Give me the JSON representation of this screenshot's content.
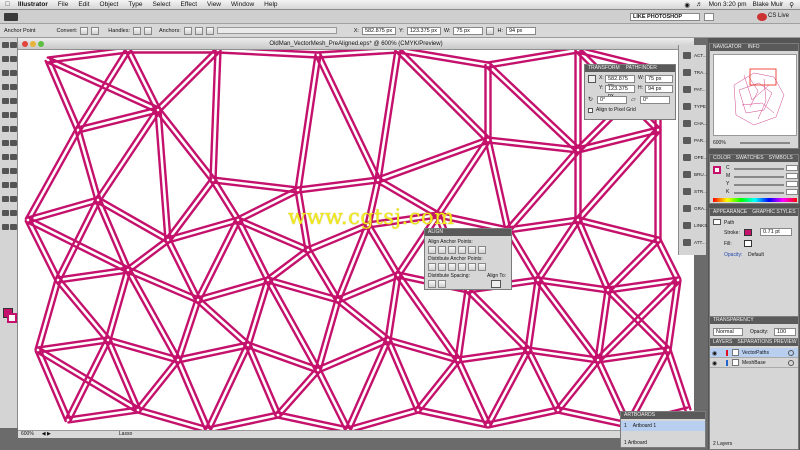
{
  "menubar": {
    "app_name": "Illustrator",
    "items": [
      "File",
      "Edit",
      "Object",
      "Type",
      "Select",
      "Effect",
      "View",
      "Window",
      "Help"
    ],
    "clock": "Mon 3:20 pm",
    "user": "Blake Muir"
  },
  "appbar": {
    "workspace": "LIKE PHOTOSHOP",
    "cs_live": "CS Live"
  },
  "controlbar": {
    "tool_label": "Anchor Point",
    "convert_label": "Convert:",
    "handles_label": "Handles:",
    "anchors_label": "Anchors:",
    "x_label": "X:",
    "x_value": "582.875 px",
    "y_label": "Y:",
    "y_value": "123.375 px",
    "w_label": "W:",
    "w_value": "75 px",
    "h_label": "H:",
    "h_value": "94 px"
  },
  "document": {
    "title": "OldMan_VectorMesh_PreAligned.eps* @ 600% (CMYK/Preview)",
    "zoom": "600%",
    "status_tool": "Lasso",
    "watermark": "www.cgtsj.com",
    "stroke_color": "#c4116b"
  },
  "transform_panel": {
    "tabs": [
      "TRANSFORM",
      "PATHFINDER"
    ],
    "x_label": "X:",
    "x_value": "582.875 px",
    "y_label": "Y:",
    "y_value": "123.375 px",
    "w_label": "W:",
    "w_value": "75 px",
    "h_label": "H:",
    "h_value": "94 px",
    "rotate_value": "0°",
    "shear_value": "0°",
    "align_pixel_grid": "Align to Pixel Grid"
  },
  "align_panel": {
    "tab": "ALIGN",
    "align_objects": "Align Anchor Points:",
    "distribute_objects": "Distribute Anchor Points:",
    "distribute_spacing": "Distribute Spacing:",
    "align_to": "Align To:"
  },
  "dock_icons": [
    {
      "label": "ACT...",
      "icon": "actions-icon"
    },
    {
      "label": "TRA...",
      "icon": "transform-icon"
    },
    {
      "label": "PAT...",
      "icon": "pathfinder-icon"
    },
    {
      "label": "TYPE",
      "icon": "type-icon"
    },
    {
      "label": "CHA...",
      "icon": "character-icon"
    },
    {
      "label": "PAR...",
      "icon": "paragraph-icon"
    },
    {
      "label": "OPE...",
      "icon": "opentype-icon"
    },
    {
      "label": "BRU...",
      "icon": "brushes-icon"
    },
    {
      "label": "STR...",
      "icon": "stroke-icon"
    },
    {
      "label": "GRA...",
      "icon": "gradient-icon"
    },
    {
      "label": "LINKS",
      "icon": "links-icon"
    },
    {
      "label": "ATT...",
      "icon": "attributes-icon"
    }
  ],
  "navigator": {
    "tabs": [
      "NAVIGATOR",
      "INFO"
    ],
    "zoom": "600%"
  },
  "color_panel": {
    "tabs": [
      "COLOR",
      "SWATCHES",
      "SYMBOLS"
    ],
    "channels": [
      "C",
      "M",
      "Y",
      "K"
    ]
  },
  "appearance_panel": {
    "tabs": [
      "APPEARANCE",
      "GRAPHIC STYLES"
    ],
    "object": "Path",
    "stroke_label": "Stroke:",
    "stroke_weight": "0.71 pt",
    "fill_label": "Fill:",
    "opacity_label": "Opacity:",
    "opacity_value": "Default"
  },
  "transparency_panel": {
    "tab": "TRANSPARENCY",
    "mode": "Normal",
    "opacity_label": "Opacity:",
    "opacity_value": "100"
  },
  "layers_panel": {
    "tabs": [
      "LAYERS",
      "SEPARATIONS PREVIEW"
    ],
    "layers": [
      "VectorPaths",
      "MeshBase"
    ],
    "footer": "2 Layers"
  },
  "artboards_panel": {
    "tab": "ARTBOARDS",
    "rows": [
      {
        "num": "1",
        "name": "Artboard 1"
      }
    ],
    "footer": "1 Artboard"
  }
}
